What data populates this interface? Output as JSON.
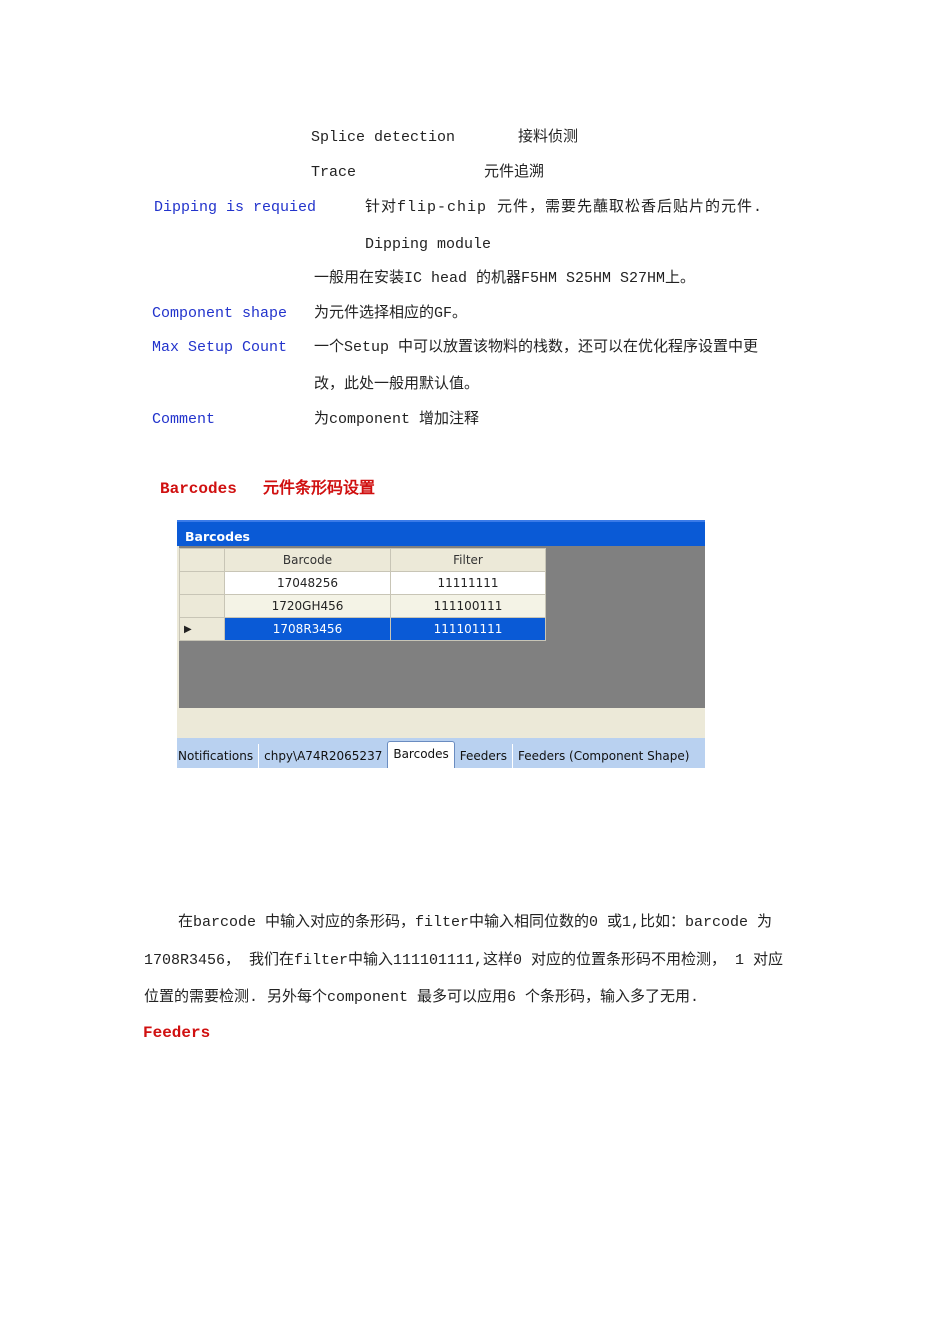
{
  "definitions": {
    "splice_term": "Splice detection",
    "splice_desc": "接料侦测",
    "trace_term": "Trace",
    "trace_desc": "元件追溯",
    "dipping_term": "Dipping is requied",
    "dipping_desc": "针对flip-chip 元件，需要先蘸取松香后贴片的元件.",
    "dipping_module": "Dipping module",
    "dipping_usage": "一般用在安装IC head 的机器F5HM  S25HM  S27HM上。",
    "shape_term": "Component shape",
    "shape_desc": "为元件选择相应的GF。",
    "max_term": "Max Setup Count",
    "max_desc_1": "一个Setup 中可以放置该物料的栈数，还可以在优化程序设置中更",
    "max_desc_2": "改，此处一般用默认值。",
    "comment_term": "Comment",
    "comment_desc": "为component 增加注释"
  },
  "barcodes_heading": {
    "en": "Barcodes",
    "zh": "元件条形码设置"
  },
  "window": {
    "title": "Barcodes",
    "columns": [
      "Barcode",
      "Filter"
    ],
    "rows": [
      {
        "barcode": "17048256",
        "filter": "11111111"
      },
      {
        "barcode": "1720GH456",
        "filter": "111100111"
      },
      {
        "barcode": "1708R3456",
        "filter": "111101111",
        "selected": true
      }
    ],
    "row_indicator": "▶",
    "tabs": [
      "Notifications",
      "chpy\\A74R2065237",
      "Barcodes",
      "Feeders",
      "Feeders (Component Shape)"
    ],
    "active_tab": "Barcodes"
  },
  "paragraph": [
    "在barcode 中输入对应的条形码，filter中输入相同位数的0 或1,比如：barcode 为",
    "1708R3456， 我们在filter中输入111101111,这样0 对应的位置条形码不用检测， 1 对应",
    "位置的需要检测.  另外每个component 最多可以应用6 个条形码，输入多了无用."
  ],
  "feeders_heading": "Feeders"
}
